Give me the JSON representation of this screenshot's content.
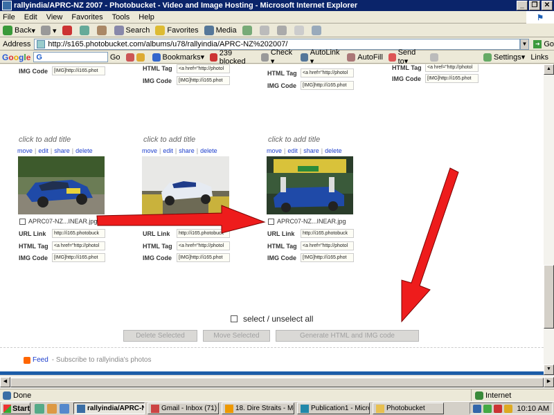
{
  "window": {
    "title": "rallyindia/APRC-NZ 2007 - Photobucket - Video and Image Hosting - Microsoft Internet Explorer",
    "controls": [
      "_",
      "❐",
      "✕"
    ]
  },
  "menu": [
    "File",
    "Edit",
    "View",
    "Favorites",
    "Tools",
    "Help"
  ],
  "toolbar": {
    "back": "Back",
    "search": "Search",
    "favorites": "Favorites",
    "media": "Media"
  },
  "address": {
    "label": "Address",
    "url": "http://s165.photobucket.com/albums/u78/rallyindia/APRC-NZ%202007/",
    "go": "Go"
  },
  "google_bar": {
    "logo": "Google",
    "search_value": "G",
    "go": "Go",
    "items": [
      "Bookmarks▾",
      "239 blocked",
      "Check ▾",
      "AutoLink ▾",
      "AutoFill",
      "Send to▾",
      "Settings▾",
      "Links"
    ]
  },
  "labels": {
    "url_link": "URL Link",
    "html_tag": "HTML Tag",
    "img_code": "IMG Code"
  },
  "values": {
    "url": "http://i165.photobuck",
    "html": "<a href=\"http://photol",
    "img": "[IMG]http://i165.phot",
    "img_alt": "[!MG]http://i165.phot"
  },
  "cards": [
    {
      "title": "click to add title",
      "actions": [
        "move",
        "edit",
        "share",
        "delete"
      ],
      "filename": "APRC07-NZ...INEAR.jpg"
    },
    {
      "title": "click to add title",
      "actions": [
        "move",
        "edit",
        "share",
        "delete"
      ],
      "filename": ""
    },
    {
      "title": "click to add title",
      "actions": [
        "move",
        "edit",
        "share",
        "delete"
      ],
      "filename": "APRC07-NZ...INEAR.jpg"
    }
  ],
  "select_all": "select / unselect all",
  "buttons": {
    "delete": "Delete Selected",
    "move": "Move Selected",
    "generate": "Generate HTML and IMG code"
  },
  "feed": {
    "link": "Feed",
    "text": "- Subscribe to rallyindia's photos"
  },
  "status": {
    "text": "Done",
    "zone": "Internet"
  },
  "taskbar": {
    "start": "Start",
    "tasks": [
      "rallyindia/APRC-N...",
      "Gmail - Inbox (71) - ...",
      "18. Dire Straits - Mo...",
      "Publication1 - Micros...",
      "Photobucket"
    ],
    "clock": "10:10 AM"
  },
  "colors": {
    "arrow": "#ee1c1c",
    "link": "#1a3ccc",
    "title_bar": "#0a246a"
  }
}
